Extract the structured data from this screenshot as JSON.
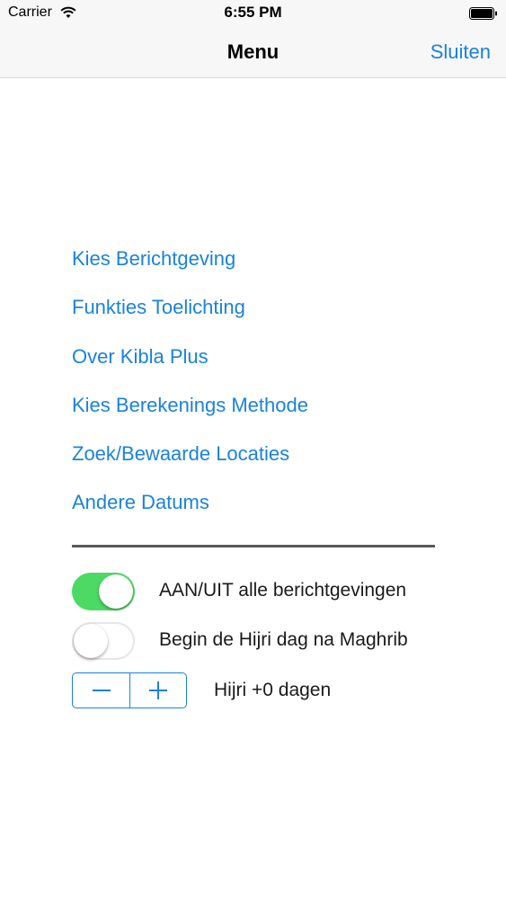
{
  "status_bar": {
    "carrier": "Carrier",
    "time": "6:55 PM",
    "wifi_icon": "wifi-icon",
    "battery_icon": "battery-icon"
  },
  "nav": {
    "title": "Menu",
    "close_label": "Sluiten"
  },
  "menu": {
    "items": [
      {
        "label": "Kies Berichtgeving"
      },
      {
        "label": "Funkties Toelichting"
      },
      {
        "label": "Over Kibla Plus"
      },
      {
        "label": "Kies Berekenings Methode"
      },
      {
        "label": "Zoek/Bewaarde Locaties"
      },
      {
        "label": "Andere Datums"
      }
    ]
  },
  "settings": {
    "notifications_toggle": {
      "label": "AAN/UIT alle berichtgevingen",
      "on": true
    },
    "hijri_maghrib_toggle": {
      "label": "Begin de Hijri dag na Maghrib",
      "on": false
    },
    "hijri_offset": {
      "label": "Hijri +0 dagen",
      "decrement_icon": "minus-icon",
      "increment_icon": "plus-icon"
    }
  },
  "colors": {
    "accent": "#1a82dc",
    "toggle_on": "#4cd964",
    "divider": "#5a5a5a",
    "nav_background": "#f7f7f7"
  }
}
